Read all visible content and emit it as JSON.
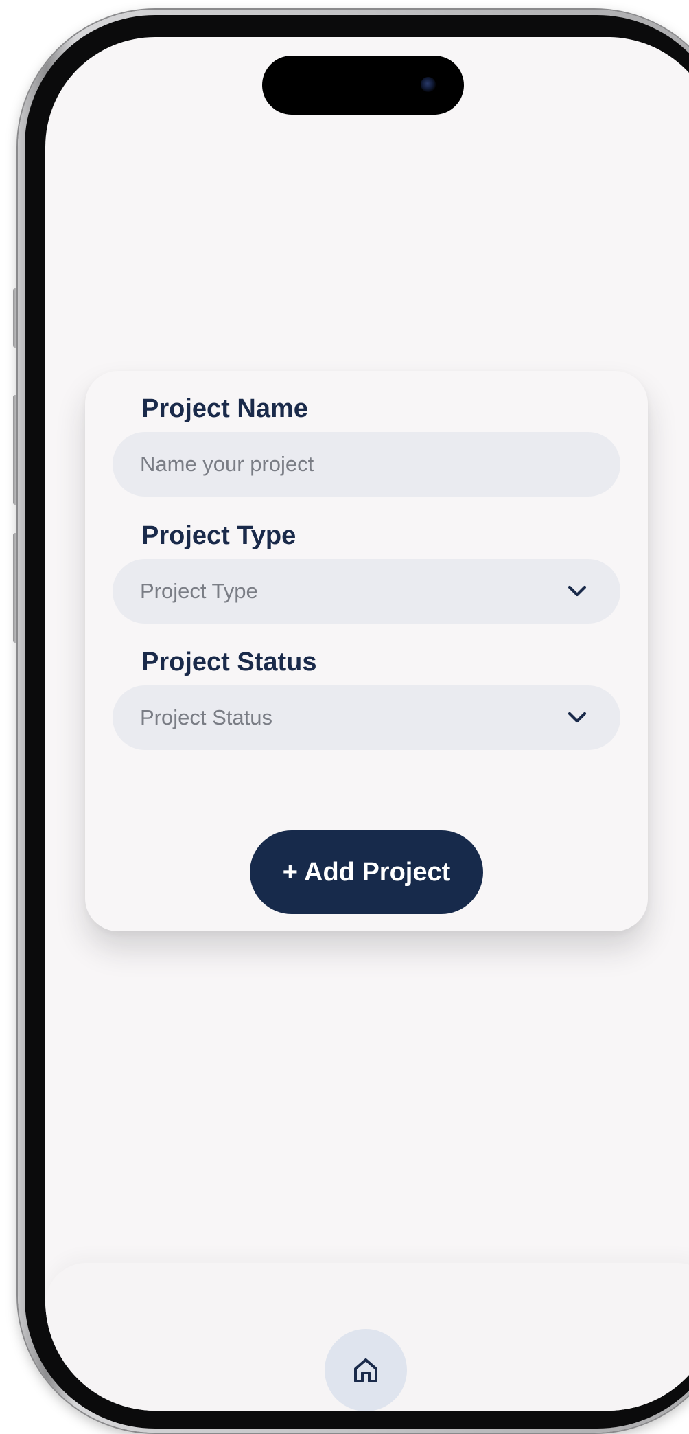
{
  "form": {
    "project_name": {
      "label": "Project Name",
      "value": "",
      "placeholder": "Name your project"
    },
    "project_type": {
      "label": "Project Type",
      "selected": "Project Type"
    },
    "project_status": {
      "label": "Project Status",
      "selected": "Project Status"
    },
    "submit_label": "+ Add Project"
  },
  "nav": {
    "items": [
      {
        "icon": "home-icon"
      }
    ]
  },
  "colors": {
    "primary": "#172a4b",
    "label": "#1a2a4a",
    "field_bg": "#eaebf0",
    "screen_bg": "#f8f6f7",
    "nav_button_bg": "#dfe4ee"
  }
}
